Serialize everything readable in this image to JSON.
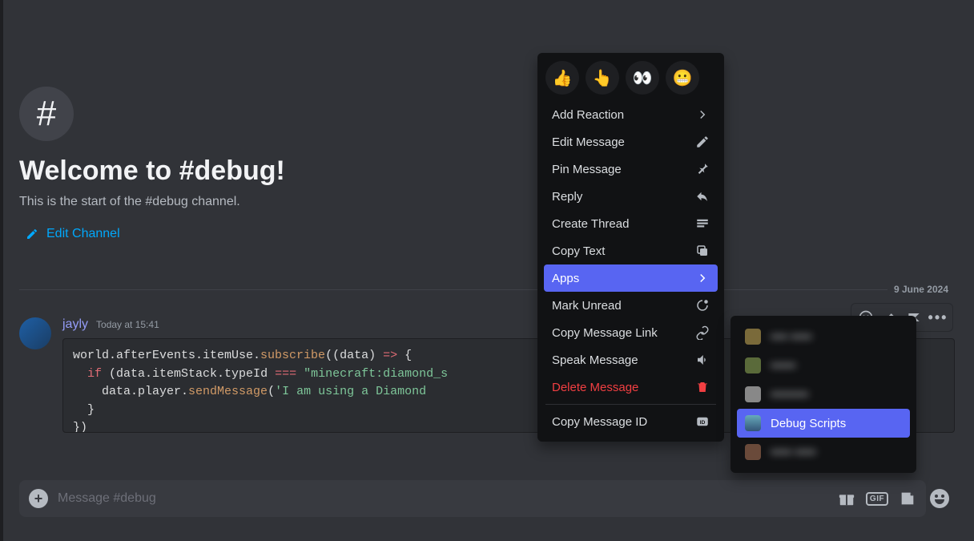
{
  "welcome": {
    "title": "Welcome to #debug!",
    "subtitle": "This is the start of the #debug channel.",
    "edit_label": "Edit Channel"
  },
  "divider_date": "9 June 2024",
  "message": {
    "author": "jayly",
    "timestamp": "Today at 15:41",
    "code": {
      "l1a": "world.afterEvents.itemUse.",
      "l1b": "subscribe",
      "l1c": "((data) ",
      "l1d": "=>",
      "l1e": " {",
      "l2a": "if",
      "l2b": " (data.itemStack.typeId ",
      "l2c": "===",
      "l2d": "\"minecraft:diamond_s",
      "l3a": "    data.player.",
      "l3b": "sendMessage",
      "l3c": "(",
      "l3d": "'I am using a Diamond ",
      "l4": "  }",
      "l5": "})"
    }
  },
  "context_menu": {
    "reactions": [
      "👍",
      "👆",
      "👀",
      "😬"
    ],
    "items": [
      {
        "label": "Add Reaction",
        "icon": "chevron"
      },
      {
        "label": "Edit Message",
        "icon": "pencil"
      },
      {
        "label": "Pin Message",
        "icon": "pin"
      },
      {
        "label": "Reply",
        "icon": "reply"
      },
      {
        "label": "Create Thread",
        "icon": "thread"
      },
      {
        "label": "Copy Text",
        "icon": "copy"
      },
      {
        "label": "Apps",
        "icon": "chevron",
        "highlighted": true
      },
      {
        "label": "Mark Unread",
        "icon": "unread"
      },
      {
        "label": "Copy Message Link",
        "icon": "link"
      },
      {
        "label": "Speak Message",
        "icon": "speak"
      },
      {
        "label": "Delete Message",
        "icon": "trash",
        "danger": true
      },
      {
        "label": "Copy Message ID",
        "icon": "id",
        "separator_before": true
      }
    ]
  },
  "apps_submenu": {
    "items": [
      {
        "label": "•••• •••••",
        "blur": true,
        "icon_color": "#7a6a3a"
      },
      {
        "label": "••••••",
        "blur": true,
        "icon_color": "#5a6a3a"
      },
      {
        "label": "•••••••••",
        "blur": true,
        "icon_color": "#888"
      },
      {
        "label": "Debug Scripts",
        "highlighted": true,
        "icon_color": "#4a7aa5"
      },
      {
        "label": "••••• •••••",
        "blur": true,
        "icon_color": "#6a4a3a"
      }
    ]
  },
  "composer": {
    "placeholder": "Message #debug"
  }
}
